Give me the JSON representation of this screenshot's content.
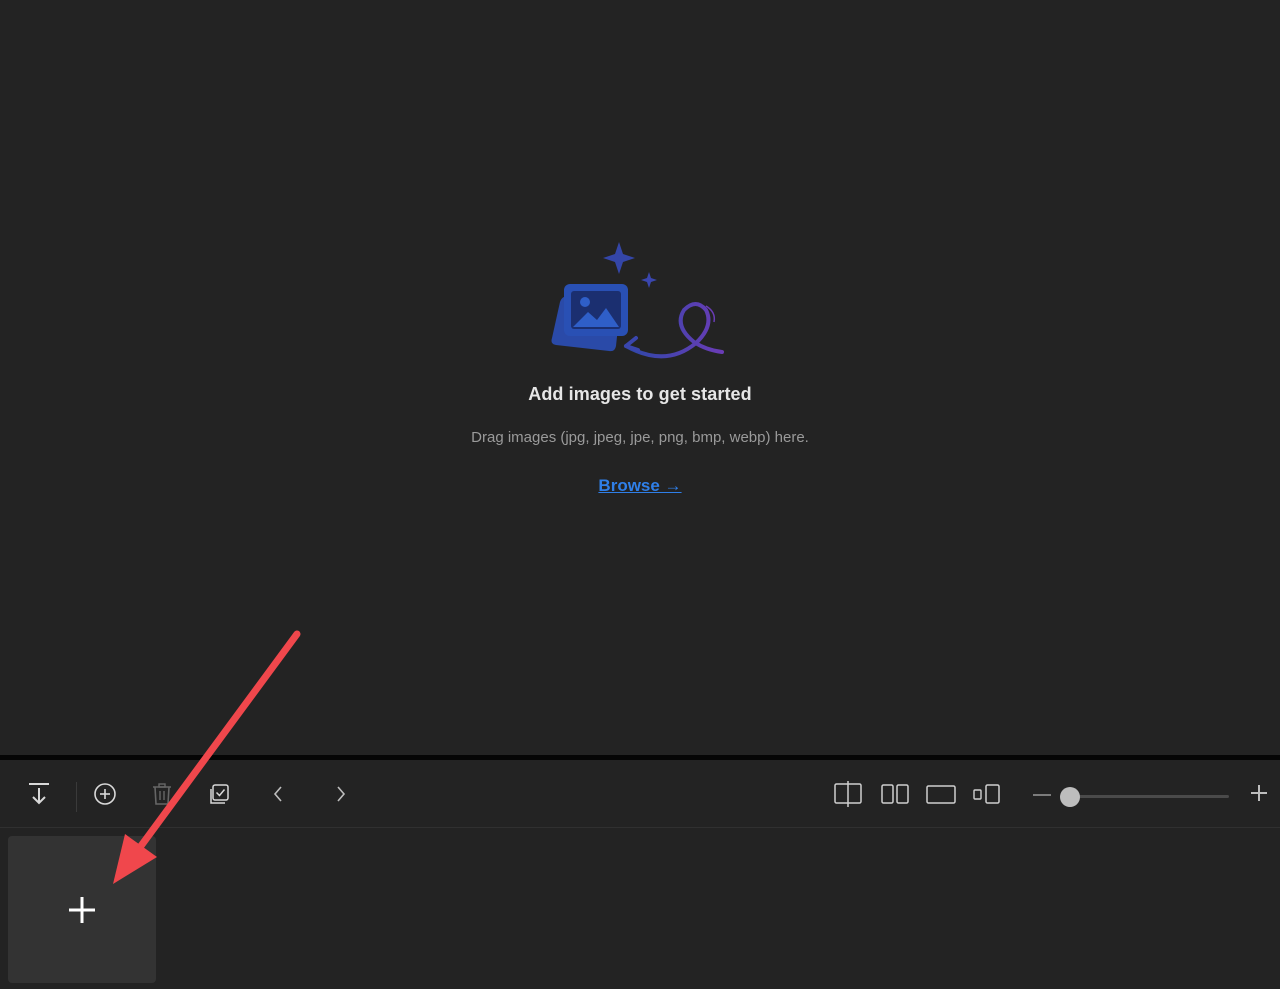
{
  "empty_state": {
    "title": "Add images to get started",
    "subtitle": "Drag images (jpg, jpeg, jpe, png, bmp, webp) here.",
    "browse_label": "Browse →"
  },
  "toolbar": {
    "buttons": [
      {
        "name": "download-button",
        "icon": "download-icon"
      },
      {
        "name": "add-button",
        "icon": "add-circle-icon"
      },
      {
        "name": "delete-button",
        "icon": "trash-icon"
      },
      {
        "name": "select-all-button",
        "icon": "checkbox-stack-icon"
      },
      {
        "name": "previous-button",
        "icon": "chevron-left-icon"
      },
      {
        "name": "next-button",
        "icon": "chevron-right-icon"
      },
      {
        "name": "view-compare-button",
        "icon": "split-view-icon"
      },
      {
        "name": "view-side-by-side-button",
        "icon": "side-by-side-icon"
      },
      {
        "name": "view-single-button",
        "icon": "single-view-icon"
      },
      {
        "name": "view-small-large-button",
        "icon": "small-large-view-icon"
      },
      {
        "name": "zoom-out-button",
        "icon": "minus-icon"
      },
      {
        "name": "zoom-in-button",
        "icon": "plus-icon"
      }
    ],
    "zoom_slider": {
      "value_fraction": 0.06
    }
  },
  "thumbnails": {
    "add_tile_icon": "plus-icon"
  },
  "colors": {
    "background": "#232323",
    "accent_link": "#2f7fe8",
    "annotation_arrow": "#f0474c",
    "illustration_blue": "#2a4aa8",
    "illustration_purple": "#5a3fb0"
  }
}
